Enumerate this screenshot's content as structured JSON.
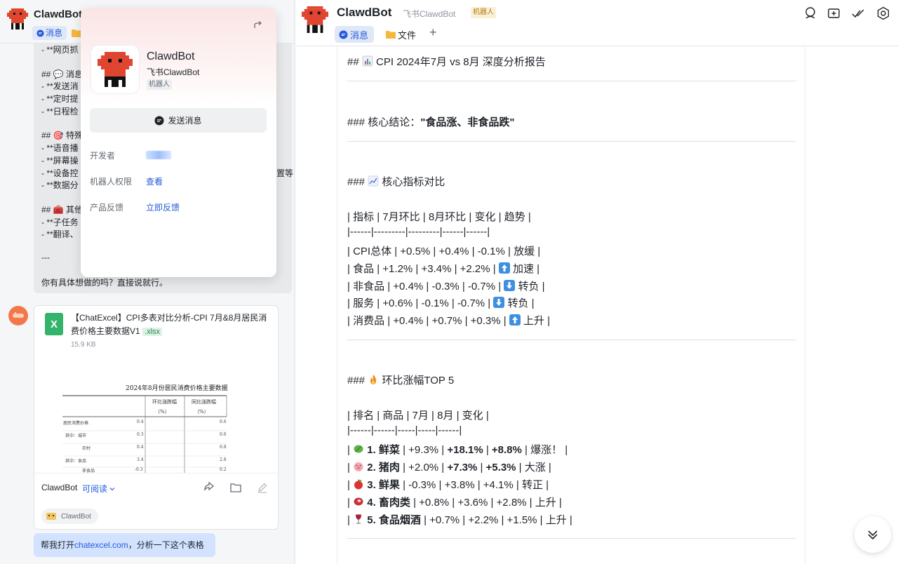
{
  "left": {
    "header": {
      "name": "ClawdBot",
      "tab_label": "消息"
    },
    "md_lines": [
      "- **网页抓",
      "## 💬 消息",
      "- **发送消",
      "- **定时提",
      "- **日程检",
      "## 🎯 特殊",
      "- **语音播",
      "- **屏幕操",
      "- **设备控",
      "- **数据分",
      "## 🧰 其他",
      "- **子任务",
      "- **翻译、",
      "---",
      "你有具体想做的吗？直接说就行。"
    ],
    "md_tail": "置等",
    "file_card": {
      "icon_letter": "X",
      "title": "【ChatExcel】CPI多表对比分析-CPI 7月&8月居民消费价格主要数据V1",
      "ext": ".xlsx",
      "size": "15.9 KB",
      "preview": {
        "title": "2024年8月份居民消费价格主要数据",
        "col1": "环比涨跌幅",
        "col2": "同比涨跌幅",
        "unit": "（%）",
        "rows": [
          [
            "居民消费价格",
            "0.4",
            "0.6"
          ],
          [
            "其中：城市",
            "0.3",
            "0.6"
          ],
          [
            "农村",
            "0.4",
            "0.8"
          ],
          [
            "其中：食品",
            "3.4",
            "2.8"
          ],
          [
            "非食品",
            "-0.3",
            "0.2"
          ]
        ]
      },
      "owner": "ClawdBot",
      "permission": "可阅读",
      "chip_label": "ClawdBot"
    },
    "user_message": {
      "prefix": "帮我打开",
      "link": "chatexcel.com",
      "suffix": "，分析一下这个表格"
    }
  },
  "popup": {
    "name": "ClawdBot",
    "subtitle": "飞书ClawdBot",
    "tag": "机器人",
    "send_label": "发送消息",
    "rows": [
      {
        "key": "开发者",
        "value": ""
      },
      {
        "key": "机器人权限",
        "value": "查看"
      },
      {
        "key": "产品反馈",
        "value": "立即反馈"
      }
    ]
  },
  "right": {
    "header": {
      "name": "ClawdBot",
      "subtitle": "飞书ClawdBot",
      "tag": "机器人",
      "tab_msg": "消息",
      "tab_file": "文件",
      "tab_add": "+"
    },
    "doc": {
      "h2_prefix": "## ",
      "h2_text": "CPI 2024年7月 vs 8月 深度分析报告",
      "h3_conc_prefix": "### 核心结论：",
      "h3_conc_bold": "\"食品涨、非食品跌\"",
      "h3_metric_prefix": "###",
      "h3_metric_text": "核心指标对比",
      "t1_header": "| 指标 | 7月环比 | 8月环比 | 变化 | 趋势 |",
      "t1_sep": "|------|---------|---------|------|------|",
      "t1_rows": [
        {
          "text": "| CPI总体 | +0.5% | +0.4% | -0.1% | 放缓 |",
          "arrow": "",
          "trend": ""
        },
        {
          "text": "| 食品 | +1.2% | +3.4% | +2.2% |",
          "arrow": "up",
          "trend": "加速 |"
        },
        {
          "text": "| 非食品 | +0.4% | -0.3% | -0.7% |",
          "arrow": "down",
          "trend": "转负 |"
        },
        {
          "text": "| 服务 | +0.6% | -0.1% | -0.7% |",
          "arrow": "down",
          "trend": "转负 |"
        },
        {
          "text": "| 消费品 | +0.4% | +0.7% | +0.3% |",
          "arrow": "up",
          "trend": "上升 |"
        }
      ],
      "h3_top_prefix": "###",
      "h3_top_text": "环比涨幅TOP 5",
      "t2_header": "| 排名 | 商品 | 7月 | 8月 | 变化 |",
      "t2_sep": "|------|------|-----|-----|------|",
      "t2_rows": [
        {
          "emoji": "veg",
          "rank": "1. 鲜菜",
          "jul": "+9.3%",
          "aug": "+18.1%",
          "chg": "+8.8%",
          "note": "爆涨！ |",
          "bold_vals": true
        },
        {
          "emoji": "pig",
          "rank": "2. 猪肉",
          "jul": "+2.0%",
          "aug": "+7.3%",
          "chg": "+5.3%",
          "note": "大涨 |",
          "bold_vals": true
        },
        {
          "emoji": "apple",
          "rank": "3. 鲜果",
          "jul": "-0.3%",
          "aug": "+3.8%",
          "chg": "+4.1%",
          "note": "转正 |",
          "bold_vals": false
        },
        {
          "emoji": "meat",
          "rank": "4. 畜肉类",
          "jul": "+0.8%",
          "aug": "+3.6%",
          "chg": "+2.8%",
          "note": "上升 |",
          "bold_vals": false
        },
        {
          "emoji": "wine",
          "rank": "5. 食品烟酒",
          "jul": "+0.7%",
          "aug": "+2.2%",
          "chg": "+1.5%",
          "note": "上升 |",
          "bold_vals": false
        }
      ]
    }
  }
}
